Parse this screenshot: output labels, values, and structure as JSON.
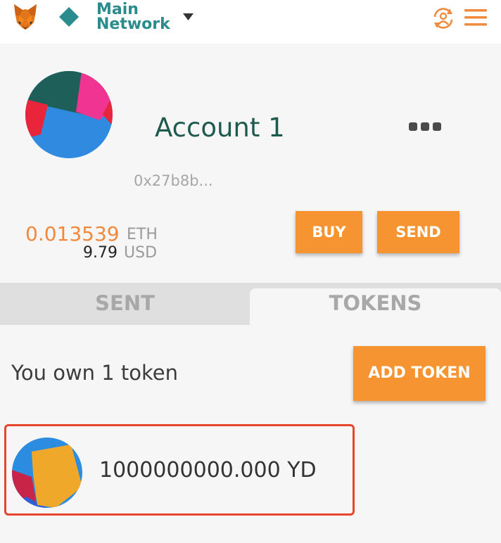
{
  "header": {
    "network_name_line1": "Main",
    "network_name_line2": "Network"
  },
  "account": {
    "name": "Account 1",
    "address": "0x27b8b...",
    "eth_amount": "0.013539",
    "eth_unit": "ETH",
    "usd_amount": "9.79",
    "usd_unit": "USD"
  },
  "actions": {
    "buy_label": "BUY",
    "send_label": "SEND"
  },
  "tabs": [
    {
      "label": "SENT",
      "active": false
    },
    {
      "label": "TOKENS",
      "active": true
    }
  ],
  "tokens": {
    "summary": "You own 1 token",
    "add_token_label": "ADD TOKEN",
    "items": [
      {
        "balance": "1000000000.000 YD"
      }
    ]
  },
  "icons": {
    "logo": "metamask-fox-icon",
    "network": "diamond-icon",
    "network_dropdown": "caret-down-icon",
    "account_switch": "account-switch-icon",
    "menu": "hamburger-menu-icon",
    "account_options": "more-options-icon"
  },
  "colors": {
    "accent_orange": "#f79432",
    "network_teal": "#2a8c8c",
    "account_green": "#1f5a4f",
    "highlight_red": "#e8452e"
  }
}
